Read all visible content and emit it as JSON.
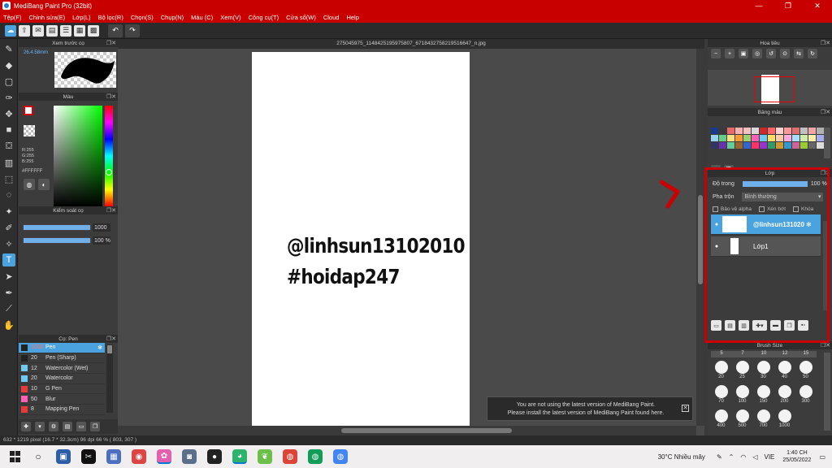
{
  "window": {
    "title": "MediBang Paint Pro (32bit)"
  },
  "menu": [
    "Tệp(F)",
    "Chỉnh sửa(E)",
    "Lớp(L)",
    "Bộ lọc(R)",
    "Chọn(S)",
    "Chụp(N)",
    "Màu (C)",
    "Xem(V)",
    "Công cụ(T)",
    "Cửa sổ(W)",
    "Cloud",
    "Help"
  ],
  "toolbar": {
    "undo_icon": "undo-icon",
    "redo_icon": "redo-icon"
  },
  "left": {
    "brush_preview_title": "Xem trước cọ",
    "brush_preview_size": "26.4.58mm",
    "color_title": "Màu",
    "rgb": "R:255\nG:255\nB:255",
    "hex": "#FFFFFF",
    "control_title": "Kiểm soát cọ",
    "size_value": "1000",
    "opacity_value": "100 %",
    "brushlist_title": "Cọ: Pen",
    "brushes": [
      {
        "size": "1000",
        "name": "Pen",
        "color": "#222222",
        "selected": true
      },
      {
        "size": "20",
        "name": "Pen (Sharp)",
        "color": "#222222"
      },
      {
        "size": "12",
        "name": "Watercolor (Wet)",
        "color": "#6fc9f0"
      },
      {
        "size": "20",
        "name": "Watercolor",
        "color": "#6fc9f0"
      },
      {
        "size": "10",
        "name": "G Pen",
        "color": "#e83a3a"
      },
      {
        "size": "50",
        "name": "Blur",
        "color": "#ff5fb5"
      },
      {
        "size": "8",
        "name": "Mapping Pen",
        "color": "#e83a3a"
      }
    ]
  },
  "canvas": {
    "tab": "275045975_1148425195975807_6718432758219516647_n.jpg",
    "line1": "@linhsun13102010",
    "line2": "#hoidap247",
    "notice_line1": "You are not using the latest version of MediBang Paint.",
    "notice_line2": "Please install the latest version of MediBang Paint found here."
  },
  "right": {
    "navigator_title": "Hoa tiêu",
    "palette_title": "Bảng màu",
    "palette_more": "---",
    "palette_colors": [
      "#1a3a8f",
      "#3a3a3a",
      "#e86a6a",
      "#ffb0b0",
      "#f4c0c0",
      "#d9d9d9",
      "#cc2a2a",
      "#ff6666",
      "#ffd0d0",
      "#ff9999",
      "#e07070",
      "#c0c0c0",
      "#f2a6a6",
      "#b0b0b0",
      "#9ad0f0",
      "#66cc88",
      "#f8e080",
      "#ff9933",
      "#9ad070",
      "#ff5fb5",
      "#6fc9f0",
      "#ffdd66",
      "#ffccaa",
      "#ffaadd",
      "#aaddff",
      "#cceeaa",
      "#ffeeaa",
      "#aaaaee",
      "#333366",
      "#6633aa",
      "#66cc99",
      "#996633",
      "#3366cc",
      "#ff3366",
      "#9933cc",
      "#339966",
      "#cc9933",
      "#3399cc",
      "#cc6699",
      "#99cc33",
      "#666666",
      "#dddddd"
    ],
    "layer_title": "Lớp",
    "opacity_label": "Độ trong",
    "opacity_value": "100 %",
    "blend_label": "Pha trộn",
    "blend_value": "Bình thường",
    "protect_alpha": "Bảo vệ alpha",
    "clipping": "Xén bớt",
    "lock": "Khóa",
    "layers": [
      {
        "name": "@linhsun131020",
        "selected": true
      },
      {
        "name": "Lớp1",
        "selected": false
      }
    ],
    "brushsize_title": "Brush Size",
    "brushsize_head": [
      "5",
      "7",
      "10",
      "12",
      "15"
    ],
    "brushsize_values": [
      "20",
      "25",
      "30",
      "40",
      "50",
      "70",
      "100",
      "150",
      "200",
      "300",
      "400",
      "500",
      "700",
      "1000"
    ]
  },
  "status": {
    "text": "632 * 1219 pixel   (16.7 * 32.3cm)   96 dpi   66 %   ( 803, 307 )"
  },
  "taskbar": {
    "weather": "30°C  Nhiều mây",
    "lang": "VIE",
    "time": "1:40 CH",
    "date": "25/05/2022"
  }
}
